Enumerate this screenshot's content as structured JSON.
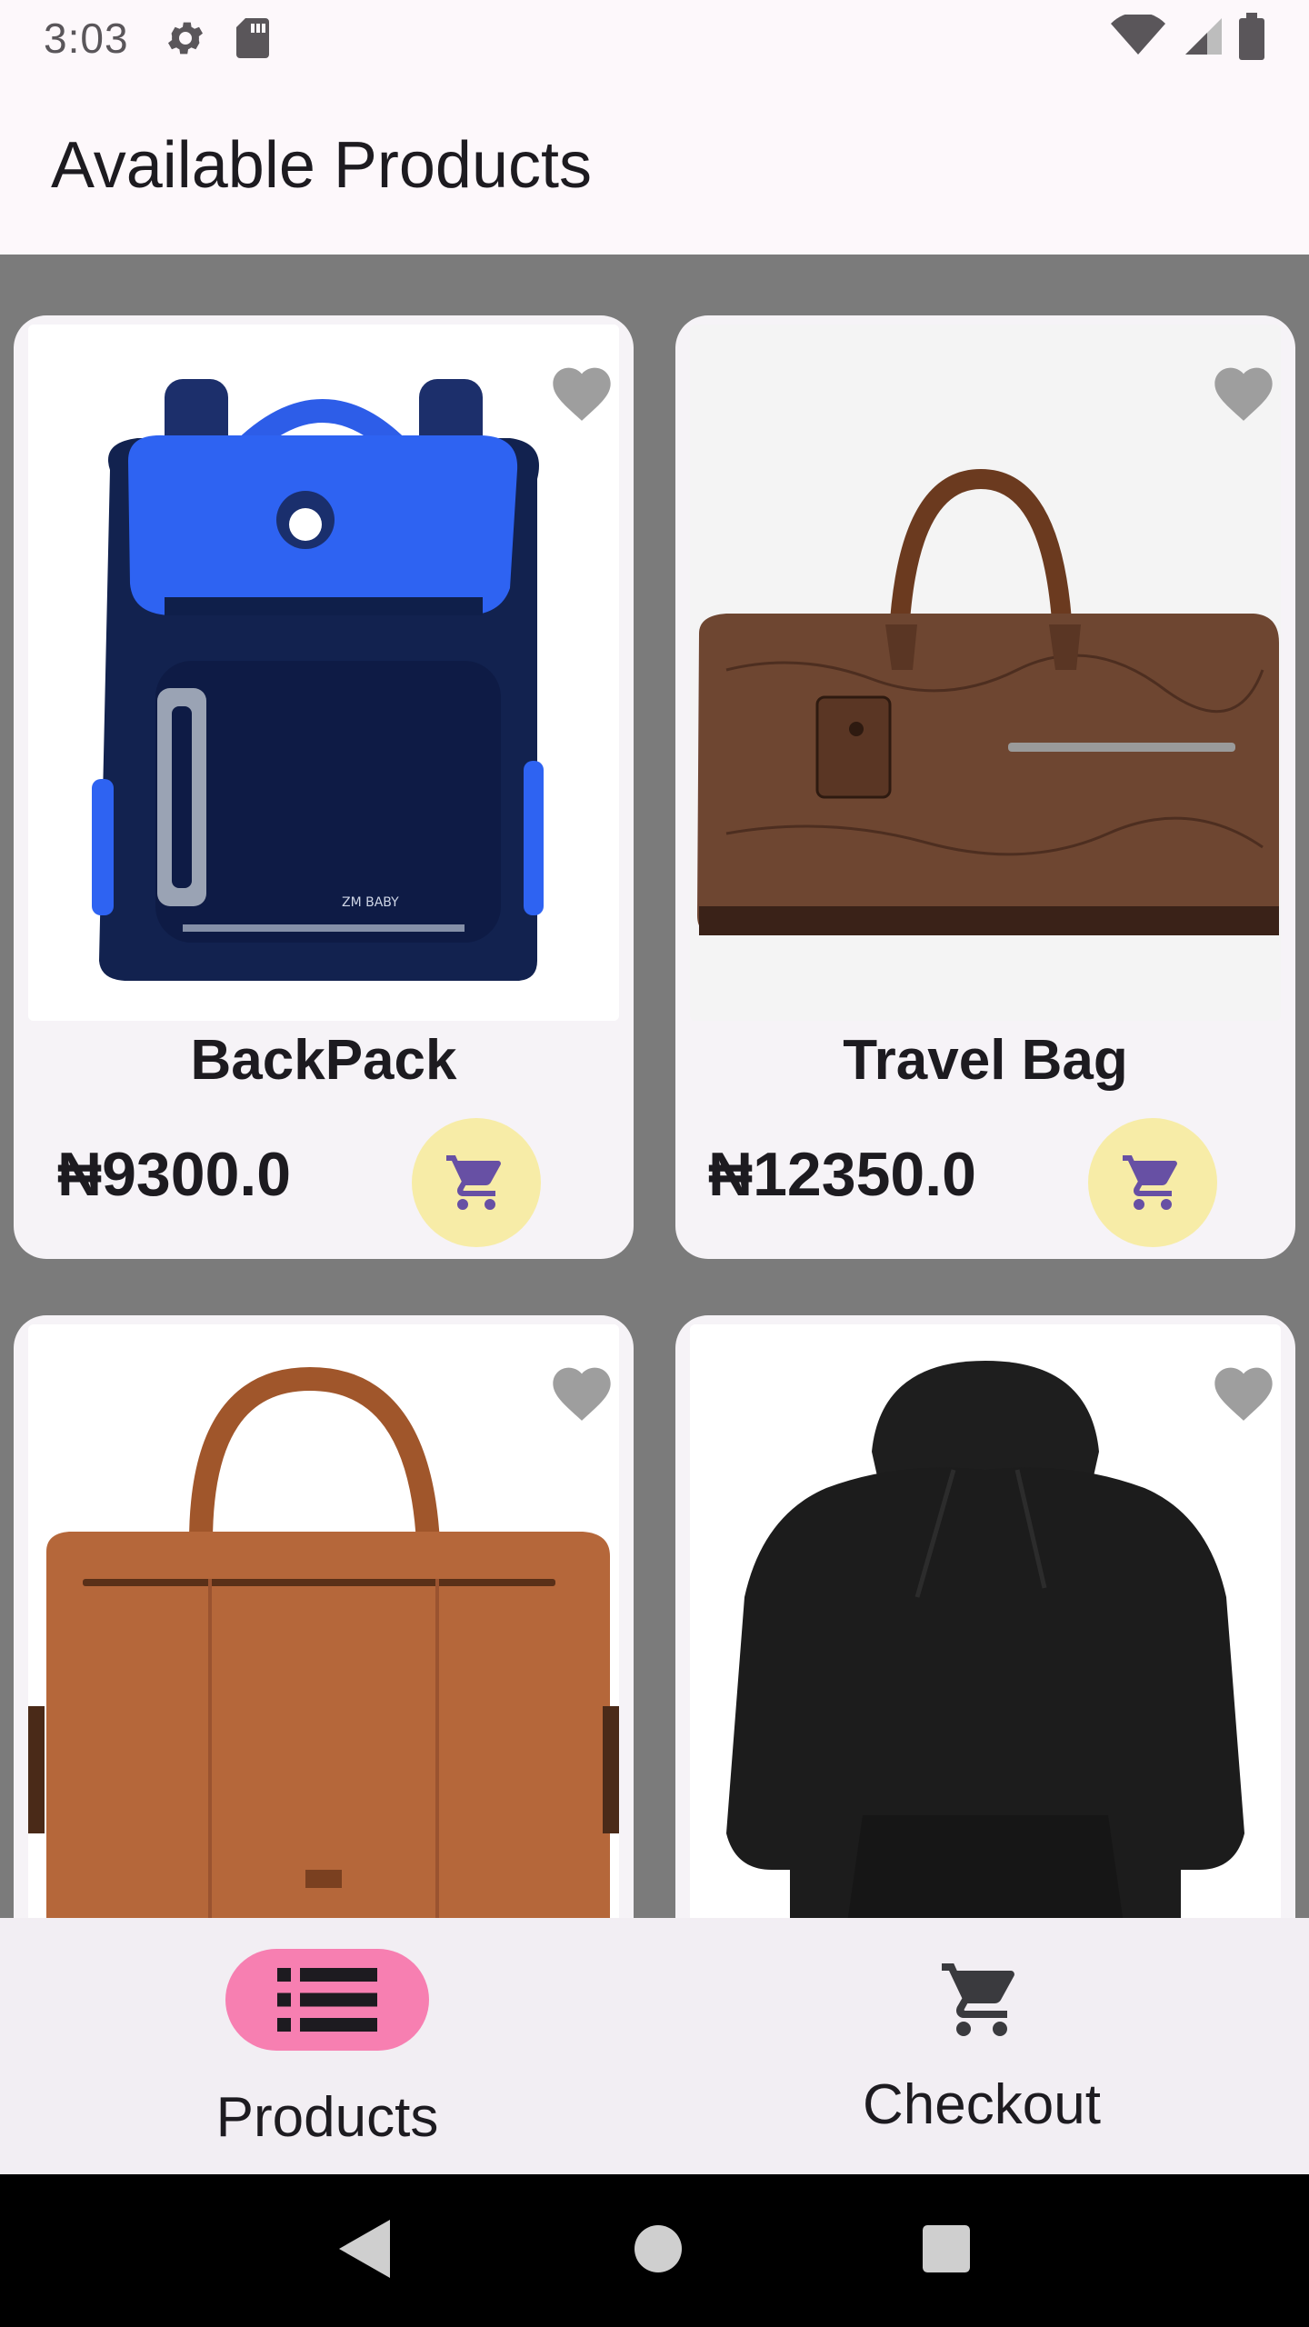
{
  "status_bar": {
    "time": "3:03",
    "left_icons": [
      "settings-icon",
      "sd-card-icon"
    ],
    "right_icons": [
      "wifi-icon",
      "signal-icon",
      "battery-icon"
    ]
  },
  "app_bar": {
    "title": "Available Products"
  },
  "products": [
    {
      "name": "BackPack",
      "price": "₦9300.0",
      "image": "blue-backpack-image"
    },
    {
      "name": "Travel Bag",
      "price": "₦12350.0",
      "image": "brown-travel-bag-image"
    },
    {
      "name": "",
      "price": "",
      "image": "leather-laptop-bag-image"
    },
    {
      "name": "",
      "price": "",
      "image": "black-hoodie-image"
    }
  ],
  "bottom_nav": {
    "items": [
      {
        "label": "Products",
        "icon": "list-icon",
        "selected": true
      },
      {
        "label": "Checkout",
        "icon": "cart-icon",
        "selected": false
      }
    ]
  },
  "system_nav": {
    "icons": [
      "back-icon",
      "home-icon",
      "recents-icon"
    ]
  },
  "colors": {
    "background": "#fdf8fb",
    "grid_background": "#7b7b7b",
    "card": "#f6f3f7",
    "cart_button": "#f7eca7",
    "cart_icon": "#6750a4",
    "nav_pill": "#f77fb1",
    "favorite_icon": "#9e9e9e"
  }
}
